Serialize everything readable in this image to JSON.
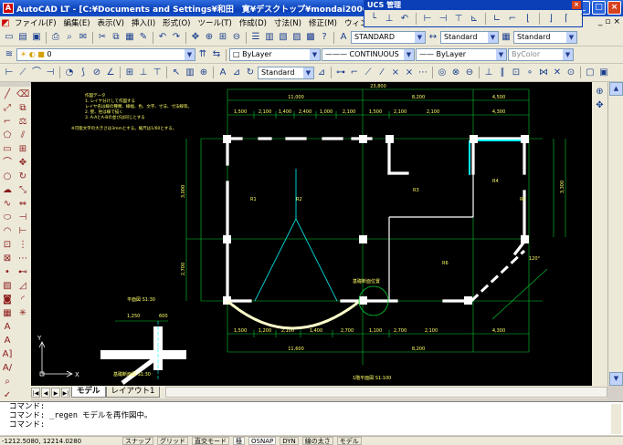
{
  "window": {
    "title": "AutoCAD LT - [C:¥Documents and Settings¥和田　寛¥デスクトップ¥mondai2006.dxf]",
    "min": "_",
    "max": "□",
    "close": "×"
  },
  "menu": [
    "ファイル(F)",
    "編集(E)",
    "表示(V)",
    "挿入(I)",
    "形式(O)",
    "ツール(T)",
    "作成(D)",
    "寸法(N)",
    "修正(M)",
    "ウィンドウ(W)",
    "ヘル"
  ],
  "ucs_panel": {
    "title": "UCS 管理",
    "close": "×"
  },
  "styles": {
    "text_style": "STANDARD",
    "dim_style": "Standard",
    "table_style": "Standard"
  },
  "layers": {
    "current": "0"
  },
  "properties": {
    "color": "ByLayer",
    "linetype": "CONTINUOUS",
    "lineweight": "ByLayer",
    "plotstyle": "ByColor"
  },
  "dimension_toolbar": {
    "style": "Standard"
  },
  "drawing": {
    "notes": [
      "作図データ",
      "1. レイヤ分けして作図する",
      "レイヤ名は線の種類、線幅、色、文字、寸法、寸法線等。",
      "2. 壁、柱は線で描く",
      "3. A-AとA-Bの並びは同じとする",
      "※可能文字の大きさは3mmとする。縮尺は1/60とする。"
    ],
    "dims_top": [
      "23,800",
      "11,000",
      "8,200",
      "4,500"
    ],
    "dims_row2": [
      "1,500",
      "2,100",
      "1,400",
      "2,400",
      "1,000",
      "2,100",
      "1,500",
      "2,100",
      "2,100",
      "4,300"
    ],
    "dims_bottom": [
      "1,500",
      "1,200",
      "2,100",
      "1,400",
      "2,700",
      "1,100",
      "2,700",
      "2,100",
      "4,300"
    ],
    "dims_bottom2": [
      "11,600",
      "8,200"
    ],
    "side_dims": [
      "3,000",
      "2,700",
      "3,300"
    ],
    "room_labels": [
      "R1",
      "R2",
      "R3",
      "R4",
      "R5",
      "R6"
    ],
    "scale_label": "平面図 S1:30",
    "title_label": "1階平面図 S1:100",
    "detail_label": "基礎断面図 S1:30",
    "detail_dims": [
      "1,250",
      "600"
    ],
    "circle_note": "基礎断面位置",
    "ucs_x": "X",
    "ucs_y": "Y",
    "angle_label": "120°"
  },
  "tabs": {
    "model": "モデル",
    "layout": "レイアウト1"
  },
  "command": {
    "line1": "コマンド:",
    "line2": "コマンド: _regen モデルを再作図中。",
    "prompt": "コマンド:"
  },
  "status": {
    "coords": "-1212.5080, 12214.0280",
    "snap": "スナップ",
    "grid": "グリッド",
    "ortho": "直交モード",
    "polar": "極",
    "osnap": "OSNAP",
    "dyn": "DYN",
    "lwt": "線の太さ",
    "model": "モデル"
  }
}
